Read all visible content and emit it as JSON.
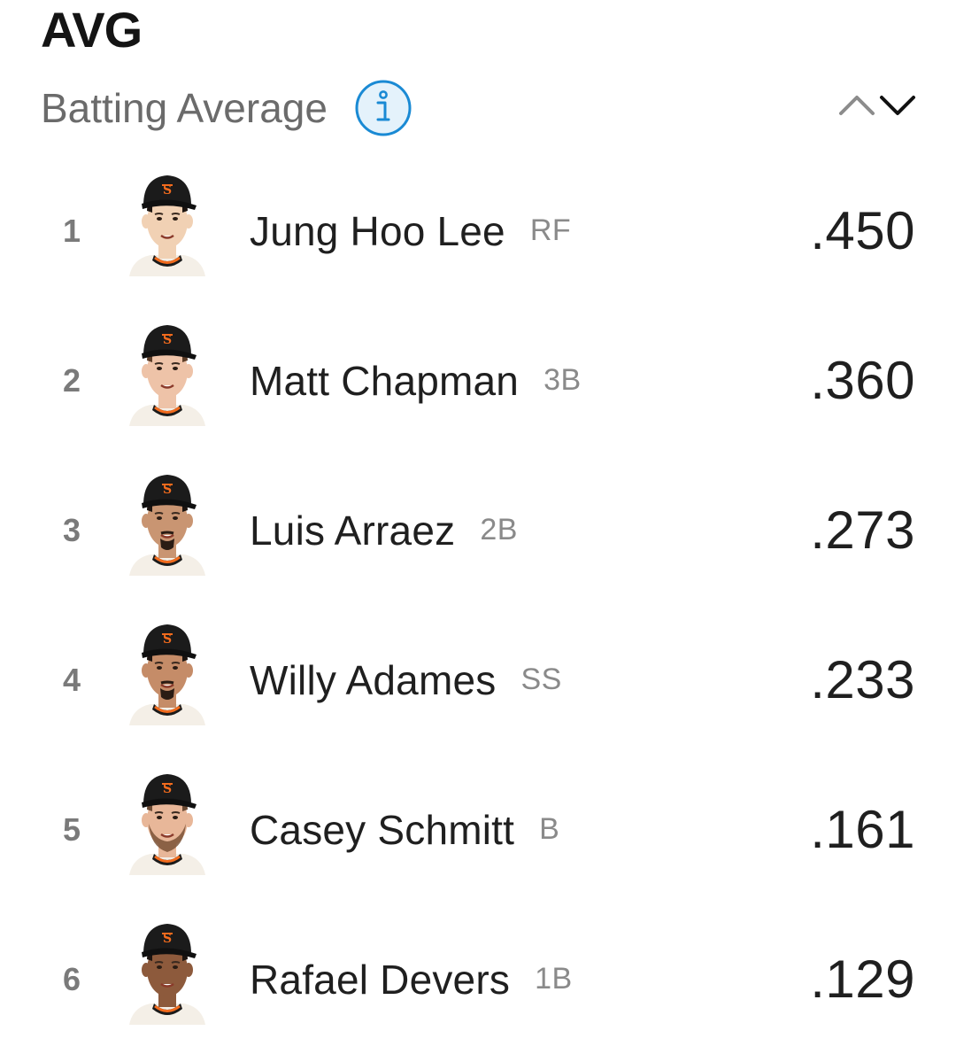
{
  "header": {
    "stat_abbrev": "AVG",
    "stat_name": "Batting Average",
    "info_icon": "info-icon",
    "sort_up_icon": "chevron-up-icon",
    "sort_down_icon": "chevron-down-icon",
    "sort_state": "descending"
  },
  "colors": {
    "info_blue": "#1a8ad4",
    "info_fill": "#e4f2fb",
    "cap_black": "#1b1b1b",
    "giants_orange": "#f26b1d",
    "chevron_inactive": "#8c8c8c",
    "chevron_active": "#111111"
  },
  "leaders": [
    {
      "rank": "1",
      "name": "Jung Hoo Lee",
      "position": "RF",
      "value": ".450",
      "skin": "#f1d1b4",
      "hair": "#1c1410",
      "beard": "none"
    },
    {
      "rank": "2",
      "name": "Matt Chapman",
      "position": "3B",
      "value": ".360",
      "skin": "#eec3a8",
      "hair": "#5c3d28",
      "beard": "none"
    },
    {
      "rank": "3",
      "name": "Luis Arraez",
      "position": "2B",
      "value": ".273",
      "skin": "#c99572",
      "hair": "#1c1410",
      "beard": "goatee"
    },
    {
      "rank": "4",
      "name": "Willy Adames",
      "position": "SS",
      "value": ".233",
      "skin": "#c58c68",
      "hair": "#1c1410",
      "beard": "goatee"
    },
    {
      "rank": "5",
      "name": "Casey Schmitt",
      "position": "B",
      "value": ".161",
      "skin": "#e8b799",
      "hair": "#6b4a33",
      "beard": "full"
    },
    {
      "rank": "6",
      "name": "Rafael Devers",
      "position": "1B",
      "value": ".129",
      "skin": "#8d5a3c",
      "hair": "#1c1410",
      "beard": "none"
    }
  ]
}
